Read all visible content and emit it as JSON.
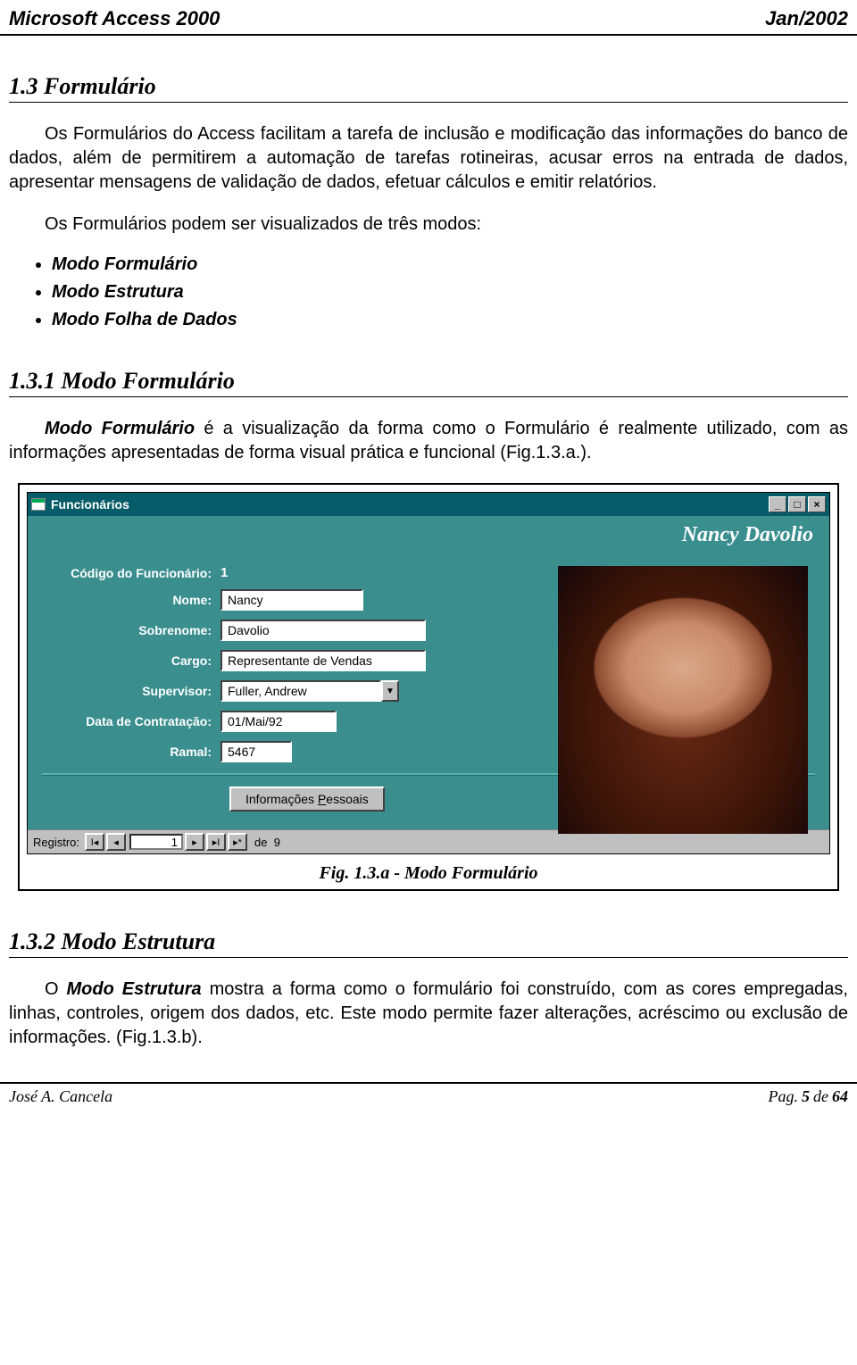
{
  "header": {
    "left": "Microsoft Access 2000",
    "right": "Jan/2002"
  },
  "sec13": {
    "title": "1.3  Formulário",
    "p1": "Os Formulários do Access facilitam a tarefa de inclusão e modificação das informações do banco de dados, além de permitirem a automação de tarefas rotineiras, acusar erros na entrada de dados, apresentar mensagens de validação de dados, efetuar cálculos e emitir relatórios.",
    "p2": "Os Formulários podem ser visualizados de três modos:",
    "modes": [
      "Modo Formulário",
      "Modo Estrutura",
      "Modo Folha de Dados"
    ]
  },
  "sec131": {
    "title": "1.3.1  Modo Formulário",
    "p_lead": "Modo Formulário",
    "p_rest": " é a visualização da forma como o Formulário é realmente utilizado, com as informações apresentadas de forma visual prática e funcional  (Fig.1.3.a.)."
  },
  "form": {
    "window_title": "Funcionários",
    "banner_name": "Nancy Davolio",
    "labels": {
      "codigo": "Código do Funcionário:",
      "nome": "Nome:",
      "sobrenome": "Sobrenome:",
      "cargo": "Cargo:",
      "supervisor": "Supervisor:",
      "contratacao": "Data de Contratação:",
      "ramal": "Ramal:"
    },
    "values": {
      "codigo": "1",
      "nome": "Nancy",
      "sobrenome": "Davolio",
      "cargo": "Representante de Vendas",
      "supervisor": "Fuller, Andrew",
      "contratacao": "01/Mai/92",
      "ramal": "5467"
    },
    "button_pessoais_pre": "Informações ",
    "button_pessoais_under": "P",
    "button_pessoais_post": "essoais",
    "recnav": {
      "label": "Registro:",
      "current": "1",
      "of_label": "de",
      "total": "9"
    },
    "winbtns": {
      "min": "_",
      "max": "□",
      "close": "×"
    }
  },
  "caption": "Fig. 1.3.a - Modo Formulário",
  "sec132": {
    "title": "1.3.2  Modo Estrutura",
    "p_lead": "Modo Estrutura",
    "p_pre": "O ",
    "p_rest": " mostra a forma como o formulário foi construído, com as cores empregadas, linhas, controles, origem dos dados, etc. Este modo permite fazer alterações, acréscimo ou exclusão de informações. (Fig.1.3.b)."
  },
  "footer": {
    "author": "José A. Cancela",
    "page_label": "Pag. ",
    "page_num": "5",
    "page_of": " de ",
    "page_total": "64"
  }
}
